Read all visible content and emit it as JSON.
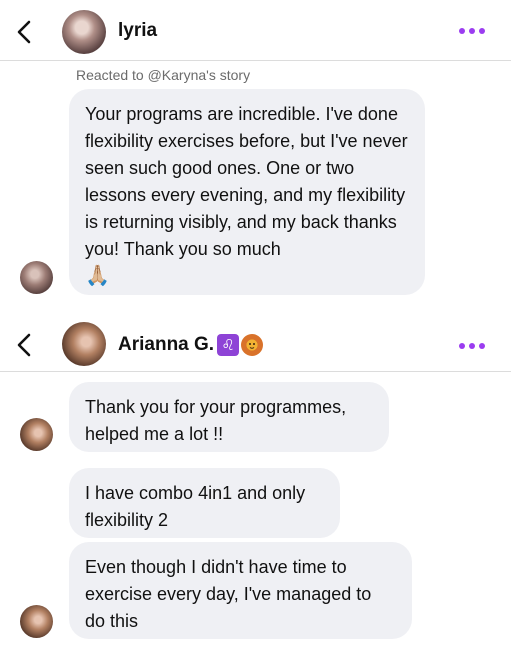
{
  "chat1": {
    "contact_name": "lyria",
    "reacted_note": "Reacted to @Karyna's story",
    "message": "Your programs are incredible. I've done flexibility exercises before, but I've never seen such good ones. One or two lessons every evening, and my flexibility is returning visibly, and my back thanks you! Thank you so much",
    "message_emoji": "🙏🏼"
  },
  "chat2": {
    "contact_name": "Arianna G.",
    "name_badges": [
      "leo-zodiac-icon",
      "lion-face-icon"
    ],
    "messages": [
      "Thank you for your programmes, helped me a lot !!",
      "I have combo 4in1 and only flexibility 2",
      "Even though I didn't have time to exercise every day, I've managed to do this"
    ]
  },
  "colors": {
    "accent": "#9b3df0",
    "bubble": "#eff0f4",
    "divider": "#dcdcdc",
    "zodiac_bg": "#8e43d6"
  }
}
